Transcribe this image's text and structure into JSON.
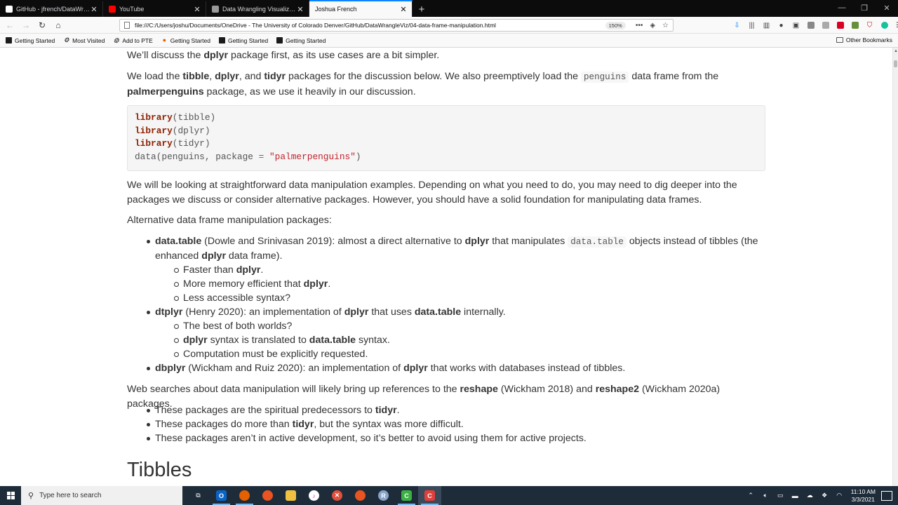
{
  "browser": {
    "tabs": [
      {
        "label": "GitHub - jfrench/DataWrangleViz",
        "favicon_color": "#24292e",
        "active": false
      },
      {
        "label": "YouTube",
        "favicon_color": "#ff0000",
        "active": false
      },
      {
        "label": "Data Wrangling Visualization & ...",
        "favicon_color": "#888888",
        "active": false
      },
      {
        "label": "Joshua French",
        "favicon_color": "#e6e6e6",
        "active": true
      }
    ],
    "url": "file:///C:/Users/joshu/Documents/OneDrive - The University of Colorado Denver/GitHub/DataWrangleViz/04-data-frame-manipulation.html",
    "zoom": "150%",
    "bookmarks": [
      {
        "label": "Getting Started",
        "icon": "bookmark-dark-icon"
      },
      {
        "label": "Most Visited",
        "icon": "gear-icon"
      },
      {
        "label": "Add to PTE",
        "icon": "globe-icon"
      },
      {
        "label": "Getting Started",
        "icon": "firefox-icon"
      },
      {
        "label": "Getting Started",
        "icon": "bookmark-dark-icon"
      },
      {
        "label": "Getting Started",
        "icon": "bookmark-dark-icon"
      }
    ],
    "other_bookmarks": "Other Bookmarks"
  },
  "doc": {
    "p1": {
      "a": "We’ll discuss the ",
      "b": "dplyr",
      "c": " package first, as its use cases are a bit simpler."
    },
    "p2": {
      "a": "We load the ",
      "b": "tibble",
      "c": ", ",
      "d": "dplyr",
      "e": ", and ",
      "f": "tidyr",
      "g": " packages for the discussion below. We also preemptively load the ",
      "h": "penguins",
      "i": " data frame from the",
      "j": "palmerpenguins",
      "k": " package, as we use it heavily in our discussion."
    },
    "code": {
      "l1_kw": "library",
      "l1_arg": "(tibble)",
      "l2_kw": "library",
      "l2_arg": "(dplyr)",
      "l3_kw": "library",
      "l3_arg": "(tidyr)",
      "l4_a": "data(penguins, package ",
      "l4_op": "=",
      "l4_str": " \"palmerpenguins\"",
      "l4_end": ")"
    },
    "p3": "We will be looking at straightforward data manipulation examples. Depending on what you need to do, you may need to dig deeper into the packages we discuss or consider alternative packages. However, you should have a solid foundation for manipulating data frames.",
    "p4": "Alternative data frame manipulation packages:",
    "alt": {
      "dt": {
        "b": "data.table",
        "a": " (Dowle and Srinivasan 2019): almost a direct alternative to ",
        "c": "dplyr",
        "d": " that manipulates ",
        "e": "data.table",
        "f": " objects instead of tibbles (the enhanced ",
        "g": "dplyr",
        "h": " data frame)."
      },
      "dt_sub": [
        {
          "a": "Faster than ",
          "b": "dplyr",
          "c": "."
        },
        {
          "a": "More memory efficient that ",
          "b": "dplyr",
          "c": "."
        },
        {
          "a": "Less accessible syntax?",
          "b": "",
          "c": ""
        }
      ],
      "dtp": {
        "b": "dtplyr",
        "a": " (Henry 2020): an implementation of ",
        "c": "dplyr",
        "d": " that uses ",
        "e": "data.table",
        "f": " internally."
      },
      "dtp_sub": [
        {
          "a": "The best of both worlds?"
        },
        {
          "b": "dplyr",
          "a": " syntax is translated to ",
          "c": "data.table",
          "d": " syntax."
        },
        {
          "a": "Computation must be explicitly requested."
        }
      ],
      "dbp": {
        "b": "dbplyr",
        "a": " (Wickham and Ruiz 2020): an implementation of ",
        "c": "dplyr",
        "d": " that works with databases instead of tibbles."
      }
    },
    "p5": {
      "a": "Web searches about data manipulation will likely bring up references to the ",
      "b": "reshape",
      "c": " (Wickham 2018) and ",
      "d": "reshape2",
      "e": " (Wickham 2020a) packages."
    },
    "reshape_list": [
      {
        "a": "These packages are the spiritual predecessors to ",
        "b": "tidyr",
        "c": "."
      },
      {
        "a": "These packages do more than ",
        "b": "tidyr",
        "c": ", but the syntax was more difficult."
      },
      {
        "a": "These packages aren’t in active development, so it’s better to avoid using them for active projects.",
        "b": "",
        "c": ""
      }
    ],
    "heading": "Tibbles"
  },
  "taskbar": {
    "search_placeholder": "Type here to search",
    "time": "11:10 AM",
    "date": "3/3/2021"
  }
}
